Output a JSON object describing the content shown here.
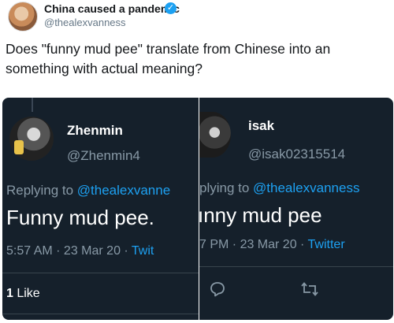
{
  "tweet": {
    "author_name": "China caused a pandemic",
    "verified_mark": "✓",
    "author_handle": "@thealexvanness",
    "text": "Does \"funny mud pee\" translate from Chinese into an something with actual meaning?"
  },
  "left_reply": {
    "name": "Zhenmin",
    "handle": "@Zhenmin4",
    "replying_prefix": "Replying to ",
    "replying_mention": "@thealexvanne",
    "body": "Funny mud pee.",
    "meta_time": "5:57 AM · 23 Mar 20 · ",
    "meta_source": "Twit",
    "likes_count": "1",
    "likes_label": " Like"
  },
  "right_reply": {
    "name": "isak",
    "handle": "@isak02315514",
    "replying_prefix": "plying to ",
    "replying_mention": "@thealexvanness",
    "body": "ınny mud pee",
    "meta_time": "7 PM · 23 Mar 20 · ",
    "meta_source": "Twitter"
  },
  "colors": {
    "twitter_blue": "#1da1f2",
    "dark_bg": "#15202b",
    "muted": "#8899a6"
  },
  "icons": [
    "verified-badge-icon",
    "reply-icon",
    "retweet-icon"
  ]
}
